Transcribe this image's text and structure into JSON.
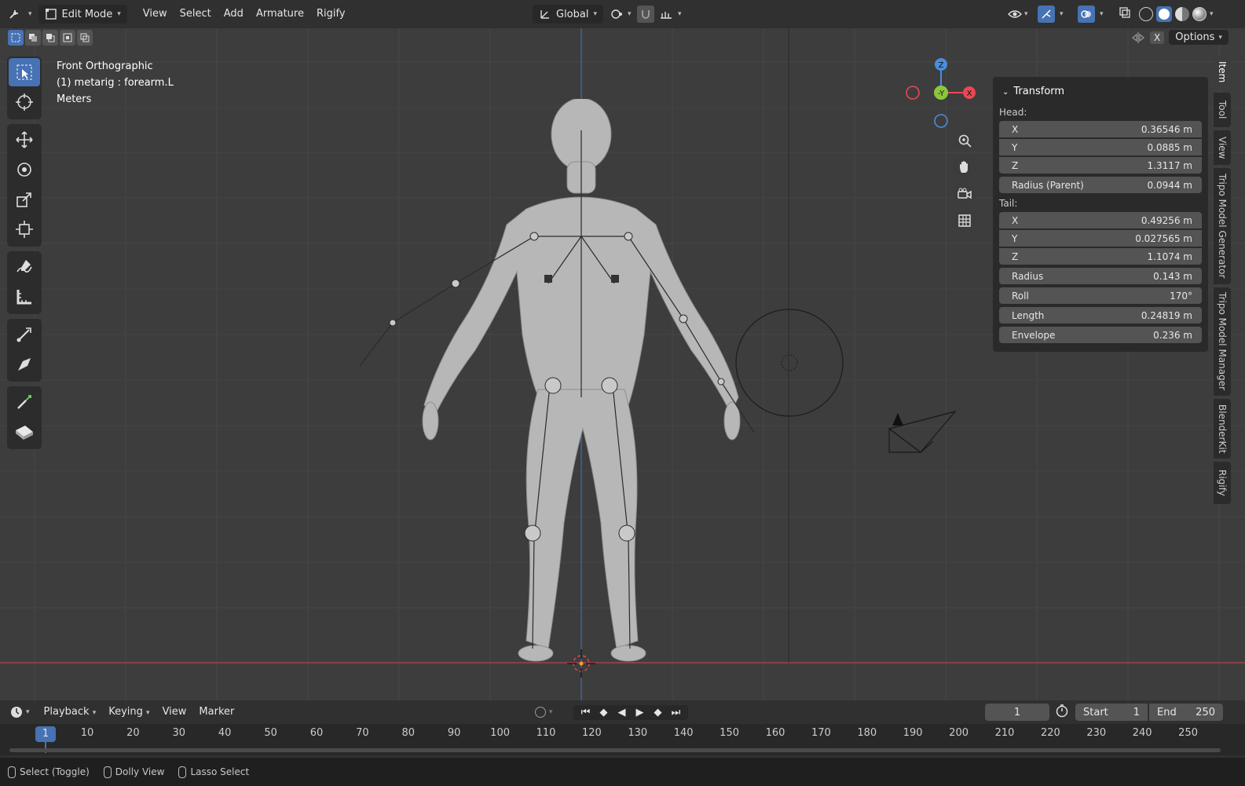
{
  "header": {
    "mode_label": "Edit Mode",
    "menus": [
      "View",
      "Select",
      "Add",
      "Armature",
      "Rigify"
    ],
    "orientation_label": "Global",
    "options_label": "Options",
    "x_label": "X"
  },
  "viewport": {
    "view_name": "Front Orthographic",
    "active_object": "(1) metarig : forearm.L",
    "units": "Meters"
  },
  "gizmo": {
    "z": "Z",
    "y": "-Y",
    "x": "X"
  },
  "transform_panel": {
    "title": "Transform",
    "head_label": "Head:",
    "head": [
      {
        "axis": "X",
        "value": "0.36546 m"
      },
      {
        "axis": "Y",
        "value": "0.0885 m"
      },
      {
        "axis": "Z",
        "value": "1.3117 m"
      }
    ],
    "radius_parent": {
      "label": "Radius (Parent)",
      "value": "0.0944 m"
    },
    "tail_label": "Tail:",
    "tail": [
      {
        "axis": "X",
        "value": "0.49256 m"
      },
      {
        "axis": "Y",
        "value": "0.027565 m"
      },
      {
        "axis": "Z",
        "value": "1.1074 m"
      }
    ],
    "radius": {
      "label": "Radius",
      "value": "0.143 m"
    },
    "roll": {
      "label": "Roll",
      "value": "170°"
    },
    "length": {
      "label": "Length",
      "value": "0.24819 m"
    },
    "envelope": {
      "label": "Envelope",
      "value": "0.236 m"
    }
  },
  "side_tabs": [
    "Item",
    "Tool",
    "View",
    "Tripo Model Generator",
    "Tripo Model Manager",
    "BlenderKit",
    "Rigify"
  ],
  "timeline": {
    "menus": [
      "Playback",
      "Keying",
      "View",
      "Marker"
    ],
    "current_frame": "1",
    "start_label": "Start",
    "start_value": "1",
    "end_label": "End",
    "end_value": "250",
    "ruler_current": "1",
    "ruler_ticks": [
      "10",
      "20",
      "30",
      "40",
      "50",
      "60",
      "70",
      "80",
      "90",
      "100",
      "110",
      "120",
      "130",
      "140",
      "150",
      "160",
      "170",
      "180",
      "190",
      "200",
      "210",
      "220",
      "230",
      "240",
      "250"
    ]
  },
  "statusbar": {
    "items": [
      "Select (Toggle)",
      "Dolly View",
      "Lasso Select"
    ]
  },
  "colors": {
    "accent": "#4772b3",
    "x_axis": "#e84855",
    "y_axis": "#8cc63f",
    "z_axis": "#4a8ddb"
  }
}
